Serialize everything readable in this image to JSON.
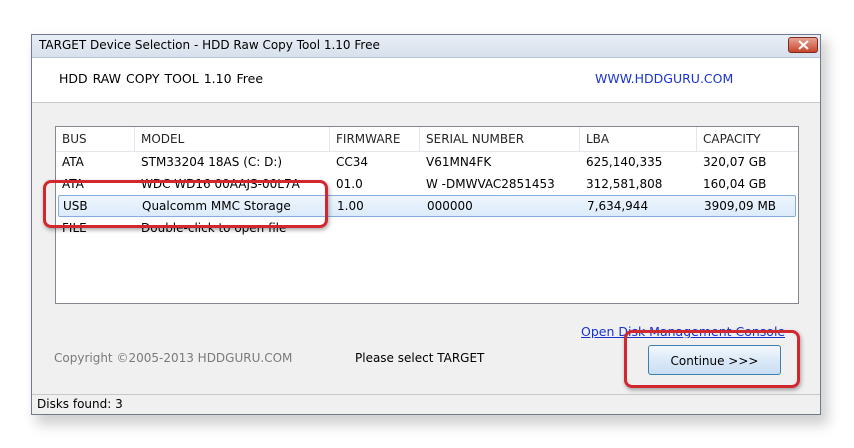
{
  "window": {
    "title": "TARGET Device Selection - HDD Raw Copy Tool 1.10   Free"
  },
  "header": {
    "app_name": "HDD RAW COPY TOOL 1.10   Free",
    "website": "WWW.HDDGURU.COM"
  },
  "device_list": {
    "columns": [
      "BUS",
      "MODEL",
      "FIRMWARE",
      "SERIAL NUMBER",
      "LBA",
      "CAPACITY"
    ],
    "rows": [
      {
        "bus": "ATA",
        "model": "STM33204 18AS (C: D:)",
        "firmware": "CC34",
        "serial": "V61MN4FK",
        "lba": "625,140,335",
        "capacity": "320,07 GB"
      },
      {
        "bus": "ATA",
        "model": "WDC WD16 00AAJS-00L7A",
        "firmware": "01.0",
        "serial": "W -DMWVAC2851453",
        "lba": "312,581,808",
        "capacity": "160,04 GB"
      },
      {
        "bus": "USB",
        "model": "Qualcomm MMC Storage",
        "firmware": "1.00",
        "serial": "000000",
        "lba": "7,634,944",
        "capacity": "3909,09 MB"
      },
      {
        "bus": "FILE",
        "model": "Double-click to open file",
        "firmware": "",
        "serial": "",
        "lba": "",
        "capacity": ""
      }
    ],
    "selected_index": 2
  },
  "footer": {
    "disk_management_link": "Open Disk Management Console",
    "copyright": "Copyright ©2005-2013 HDDGURU.COM",
    "prompt": "Please select TARGET",
    "continue_label": "Continue >>>"
  },
  "status": {
    "text": "Disks found: 3"
  },
  "colors": {
    "annotation": "#d0282e",
    "link": "#1a33cc",
    "selection": "#dcebfb"
  }
}
